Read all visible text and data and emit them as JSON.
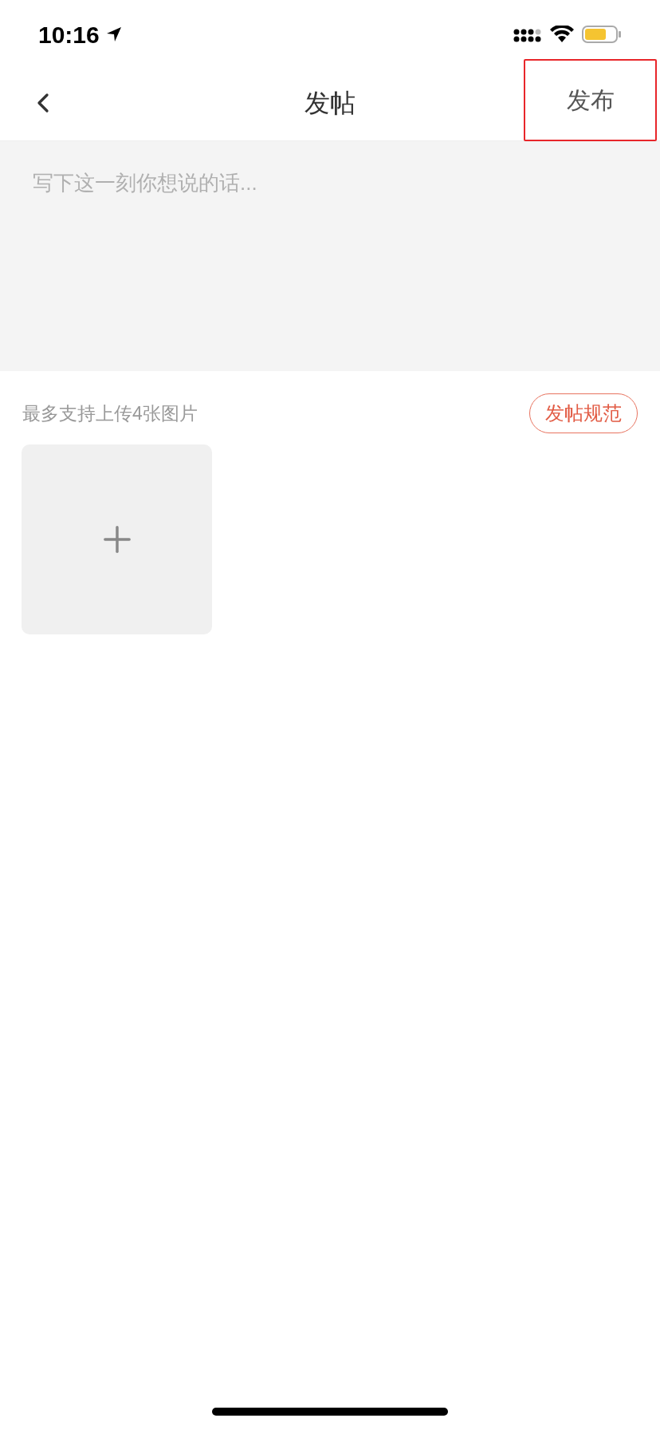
{
  "status_bar": {
    "time": "10:16"
  },
  "nav": {
    "title": "发帖",
    "publish": {
      "label": "发布",
      "highlighted": true
    }
  },
  "editor": {
    "placeholder": "写下这一刻你想说的话..."
  },
  "upload": {
    "hint": "最多支持上传4张图片",
    "rules_button": "发帖规范"
  }
}
